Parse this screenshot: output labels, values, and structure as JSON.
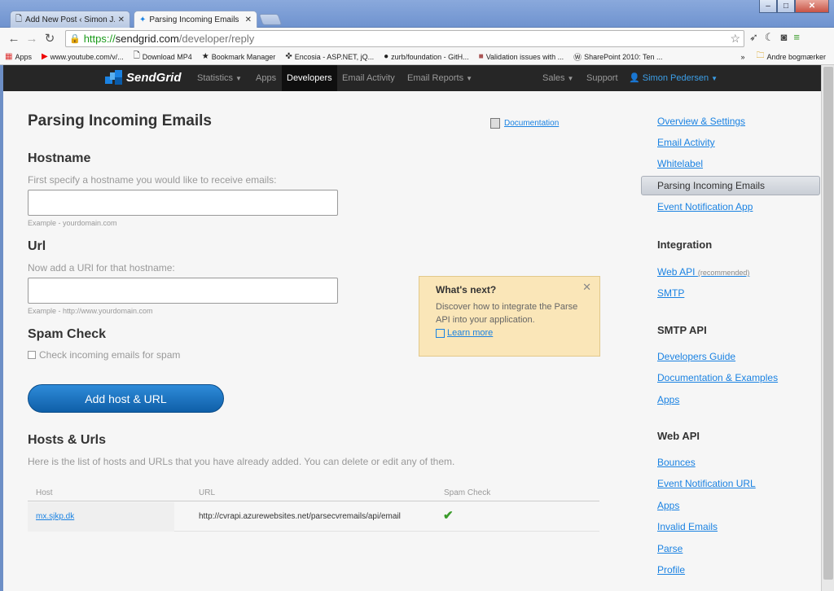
{
  "browser": {
    "tabs": [
      {
        "title": "Add New Post ‹ Simon J.K. P"
      },
      {
        "title": "Parsing Incoming Emails | Se"
      }
    ],
    "url": {
      "scheme": "https://",
      "host": "sendgrid.com",
      "path": "/developer/reply"
    },
    "bookmarks": [
      "Apps",
      "www.youtube.com/v/...",
      "Download MP4",
      "Bookmark Manager",
      "Encosia - ASP.NET, jQ...",
      "zurb/foundation - GitH...",
      "Validation issues with ...",
      "SharePoint 2010: Ten ..."
    ],
    "bookmarks_overflow": "»",
    "bookmarks_folder": "Andre bogmærker"
  },
  "topnav": {
    "logo": "SendGrid",
    "items": [
      "Statistics",
      "Apps",
      "Developers",
      "Email Activity",
      "Email Reports"
    ],
    "right": [
      "Sales",
      "Support"
    ],
    "user": "Simon Pedersen"
  },
  "main": {
    "title": "Parsing Incoming Emails",
    "doc_link": "Documentation",
    "hostname": {
      "heading": "Hostname",
      "help": "First specify a hostname you would like to receive emails:",
      "value": "",
      "example": "Example - yourdomain.com"
    },
    "url": {
      "heading": "Url",
      "help": "Now add a URl for that hostname:",
      "value": "",
      "example": "Example - http://www.yourdomain.com"
    },
    "spam": {
      "heading": "Spam Check",
      "label": "Check incoming emails for spam",
      "checked": false
    },
    "add_button": "Add host & URL",
    "list": {
      "heading": "Hosts & Urls",
      "help": "Here is the list of hosts and URLs that you have already added. You can delete or edit any of them.",
      "columns": [
        "Host",
        "URL",
        "Spam Check"
      ],
      "rows": [
        {
          "host": "mx.sjkp.dk",
          "url": "http://cvrapi.azurewebsites.net/parsecvremails/api/email",
          "spam_check": "✔"
        }
      ]
    }
  },
  "whats_next": {
    "title": "What's next?",
    "text": "Discover how to integrate the Parse API into your application.",
    "link": "Learn more",
    "close": "✕"
  },
  "sidebar": {
    "settings": [
      "Overview & Settings",
      "Email Activity",
      "Whitelabel",
      "Parsing Incoming Emails",
      "Event Notification App"
    ],
    "integration_heading": "Integration",
    "integration": [
      {
        "label": "Web API",
        "note": "(recommended)"
      },
      {
        "label": "SMTP",
        "note": ""
      }
    ],
    "smtp_heading": "SMTP API",
    "smtp": [
      "Developers Guide",
      "Documentation & Examples",
      "Apps"
    ],
    "webapi_heading": "Web API",
    "webapi": [
      "Bounces",
      "Event Notification URL",
      "Apps",
      "Invalid Emails",
      "Parse",
      "Profile"
    ]
  }
}
